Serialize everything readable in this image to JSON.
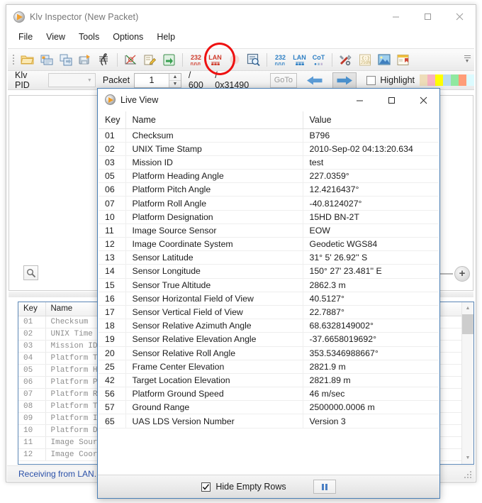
{
  "main_window": {
    "title": "Klv Inspector (New Packet)",
    "icon": "klv-app-icon",
    "window_controls": {
      "minimize": "—",
      "maximize": "□",
      "close": "✕"
    },
    "menu": [
      "File",
      "View",
      "Tools",
      "Options",
      "Help"
    ],
    "toolbar": {
      "groups": [
        [
          {
            "name": "open-folder-icon",
            "label": ""
          },
          {
            "name": "open-stream-icon",
            "label": ""
          },
          {
            "name": "import-icon",
            "label": ""
          },
          {
            "name": "save-icon",
            "label": ""
          },
          {
            "name": "waveform-icon",
            "label": ""
          }
        ],
        [
          {
            "name": "graph-icon",
            "label": ""
          },
          {
            "name": "edit-icon",
            "label": ""
          },
          {
            "name": "export-icon",
            "label": ""
          }
        ],
        [
          {
            "name": "serial-232-receive-icon",
            "label": "232"
          },
          {
            "name": "lan-receive-icon",
            "label": "LAN"
          },
          {
            "name": "record-icon",
            "label": ""
          },
          {
            "name": "inspect-icon",
            "label": ""
          }
        ],
        [
          {
            "name": "serial-232-send-icon",
            "label": "232"
          },
          {
            "name": "lan-send-icon",
            "label": "LAN"
          },
          {
            "name": "cot-send-icon",
            "label": "CoT"
          }
        ],
        [
          {
            "name": "tools-icon",
            "label": ""
          },
          {
            "name": "json-icon",
            "label": "{:}"
          },
          {
            "name": "image-icon",
            "label": ""
          },
          {
            "name": "report-icon",
            "label": ""
          }
        ]
      ],
      "overflow": "»"
    },
    "navbar": {
      "klv_pid_label": "Klv PID",
      "klv_pid_value": "",
      "packet_label": "Packet",
      "packet_value": "1",
      "packet_total": "/ 600",
      "packet_offset": "/ 0x31490",
      "goto_label": "GoTo",
      "prev_icon": "arrow-left-icon",
      "next_icon": "arrow-right-icon",
      "highlight_label": "Highlight",
      "highlight_checked": false,
      "swatches": [
        "#eeddb9",
        "#f7b3c2",
        "#ffff00",
        "#b9dced",
        "#90e8a0",
        "#ff9d78",
        "#dcfbff"
      ]
    },
    "video_pane": {
      "magnifier_icon": "magnifier-icon",
      "zoom_plus_icon": "zoom-in-icon"
    },
    "bg_table": {
      "columns": [
        "Key",
        "Name"
      ],
      "rows": [
        {
          "key": "01",
          "name": "Checksum"
        },
        {
          "key": "02",
          "name": "UNIX Time St"
        },
        {
          "key": "03",
          "name": "Mission ID"
        },
        {
          "key": "04",
          "name": "Platform Tai"
        },
        {
          "key": "05",
          "name": "Platform Hea"
        },
        {
          "key": "06",
          "name": "Platform Pit"
        },
        {
          "key": "07",
          "name": "Platform Rol"
        },
        {
          "key": "08",
          "name": "Platform Tru"
        },
        {
          "key": "09",
          "name": "Platform Ind"
        },
        {
          "key": "10",
          "name": "Platform Des"
        },
        {
          "key": "11",
          "name": "Image Source"
        },
        {
          "key": "12",
          "name": "Image Coordi"
        }
      ]
    },
    "statusbar": {
      "text": "Receiving from LAN..."
    }
  },
  "annotation": {
    "shape": "red-ellipse",
    "color": "#ee1111",
    "target": "lan-receive-icon"
  },
  "live_view": {
    "title": "Live View",
    "icon": "klv-app-icon",
    "window_controls": {
      "minimize": "—",
      "maximize": "□",
      "close": "✕"
    },
    "table": {
      "columns": [
        "Key",
        "Name",
        "Value"
      ],
      "rows": [
        {
          "key": "01",
          "name": "Checksum",
          "value": "B796"
        },
        {
          "key": "02",
          "name": "UNIX Time Stamp",
          "value": "2010-Sep-02 04:13:20.634"
        },
        {
          "key": "03",
          "name": "Mission ID",
          "value": "test"
        },
        {
          "key": "05",
          "name": "Platform Heading Angle",
          "value": "227.0359°"
        },
        {
          "key": "06",
          "name": "Platform Pitch Angle",
          "value": "12.4216437°"
        },
        {
          "key": "07",
          "name": "Platform Roll Angle",
          "value": "-40.8124027°"
        },
        {
          "key": "10",
          "name": "Platform Designation",
          "value": "15HD BN-2T"
        },
        {
          "key": "11",
          "name": "Image Source Sensor",
          "value": "EOW"
        },
        {
          "key": "12",
          "name": "Image Coordinate System",
          "value": "Geodetic WGS84"
        },
        {
          "key": "13",
          "name": "Sensor Latitude",
          "value": "31°  5' 26.92'' S"
        },
        {
          "key": "14",
          "name": "Sensor Longitude",
          "value": "150° 27' 23.481'' E"
        },
        {
          "key": "15",
          "name": "Sensor True Altitude",
          "value": "2862.3 m"
        },
        {
          "key": "16",
          "name": "Sensor Horizontal Field of View",
          "value": "40.5127°"
        },
        {
          "key": "17",
          "name": "Sensor Vertical Field of View",
          "value": "22.7887°"
        },
        {
          "key": "18",
          "name": "Sensor Relative Azimuth Angle",
          "value": "68.6328149002°"
        },
        {
          "key": "19",
          "name": "Sensor Relative Elevation Angle",
          "value": "-37.6658019692°"
        },
        {
          "key": "20",
          "name": "Sensor Relative Roll Angle",
          "value": "353.5346988667°"
        },
        {
          "key": "25",
          "name": "Frame Center Elevation",
          "value": "2821.9 m"
        },
        {
          "key": "42",
          "name": "Target Location Elevation",
          "value": "2821.89 m"
        },
        {
          "key": "56",
          "name": "Platform Ground Speed",
          "value": "46 m/sec"
        },
        {
          "key": "57",
          "name": "Ground Range",
          "value": "2500000.0006 m"
        },
        {
          "key": "65",
          "name": "UAS LDS Version Number",
          "value": "Version 3"
        }
      ]
    },
    "footer": {
      "hide_empty_label": "Hide Empty Rows",
      "hide_empty_checked": true,
      "pause_icon": "pause-icon"
    }
  }
}
